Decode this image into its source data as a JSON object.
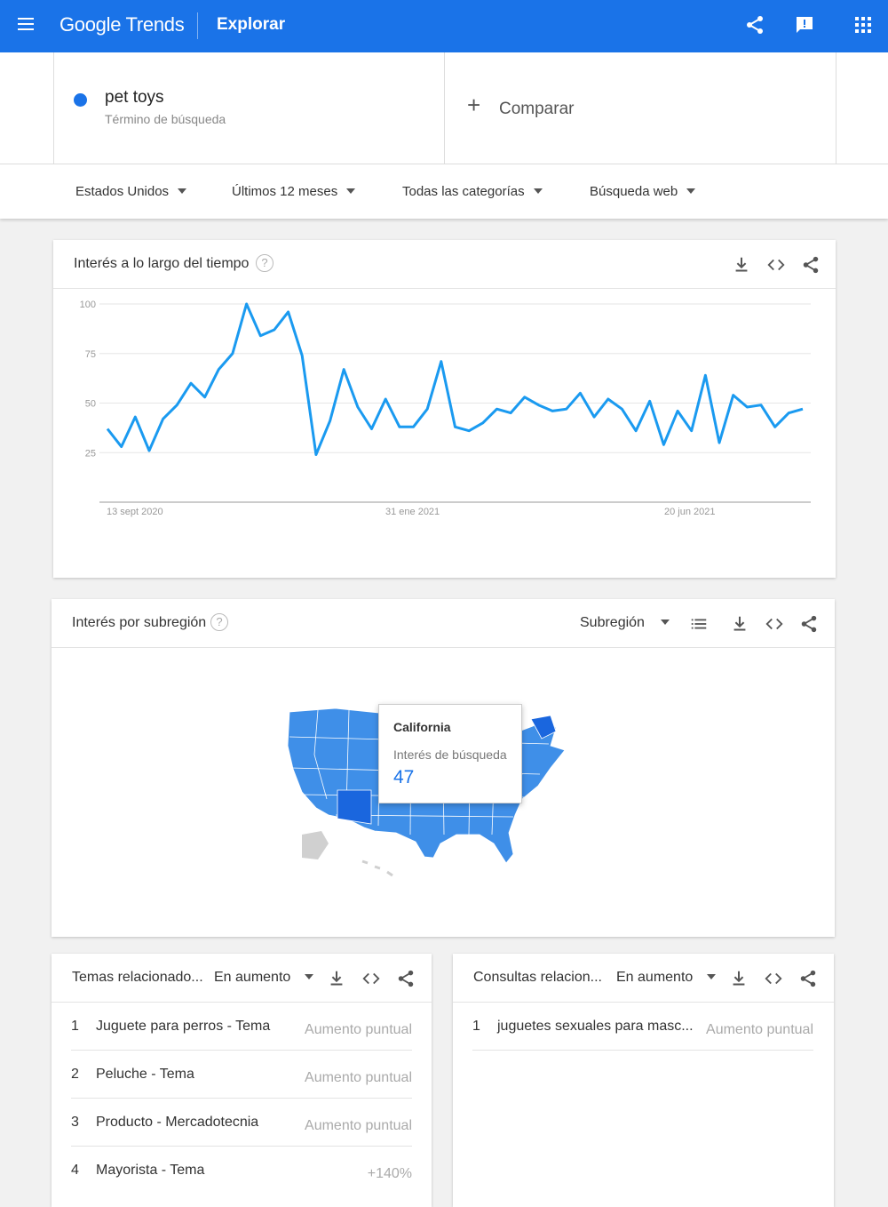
{
  "header": {
    "logo": "Google Trends",
    "page_title": "Explorar"
  },
  "search_term": {
    "name": "pet toys",
    "subtitle": "Término de búsqueda",
    "color": "#1a73e8"
  },
  "compare": {
    "label": "Comparar"
  },
  "filters": {
    "region": "Estados Unidos",
    "time": "Últimos 12 meses",
    "category": "Todas las categorías",
    "search_type": "Búsqueda web"
  },
  "interest_over_time": {
    "title": "Interés a lo largo del tiempo",
    "help": "?"
  },
  "chart_data": {
    "type": "line",
    "title": "Interés a lo largo del tiempo",
    "x_tick_labels": [
      "13 sept 2020",
      "31 ene 2021",
      "20 jun 2021"
    ],
    "y_ticks": [
      25,
      50,
      75,
      100
    ],
    "ylim": [
      0,
      100
    ],
    "grid": true,
    "series": [
      {
        "color": "#1a9af0",
        "values": [
          37,
          28,
          43,
          26,
          42,
          49,
          60,
          53,
          67,
          75,
          100,
          84,
          87,
          96,
          74,
          24,
          41,
          67,
          48,
          37,
          52,
          38,
          38,
          47,
          71,
          38,
          36,
          40,
          47,
          45,
          53,
          49,
          46,
          47,
          55,
          43,
          52,
          47,
          36,
          51,
          29,
          46,
          36,
          64,
          30,
          54,
          48,
          49,
          38,
          45,
          47
        ]
      }
    ]
  },
  "interest_by_subregion": {
    "title": "Interés por subregión",
    "help": "?",
    "dropdown": "Subregión",
    "tooltip": {
      "region": "California",
      "label": "Interés de búsqueda",
      "value": "47"
    }
  },
  "related_topics": {
    "title": "Temas relacionado...",
    "filter": "En aumento",
    "rows": [
      {
        "num": "1",
        "text": "Juguete para perros - Tema",
        "value": "Aumento puntual"
      },
      {
        "num": "2",
        "text": "Peluche - Tema",
        "value": "Aumento puntual"
      },
      {
        "num": "3",
        "text": "Producto - Mercadotecnia",
        "value": "Aumento puntual"
      },
      {
        "num": "4",
        "text": "Mayorista - Tema",
        "value": "+140%"
      }
    ]
  },
  "related_queries": {
    "title": "Consultas relacion...",
    "filter": "En aumento",
    "rows": [
      {
        "num": "1",
        "text": "juguetes sexuales para masc...",
        "value": "Aumento puntual"
      }
    ]
  }
}
